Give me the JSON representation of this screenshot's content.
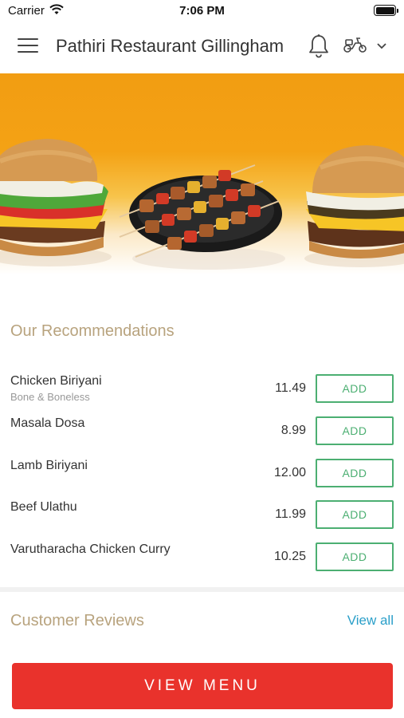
{
  "status_bar": {
    "carrier": "Carrier",
    "time": "7:06 PM"
  },
  "header": {
    "title": "Pathiri Restaurant Gillingham",
    "icons": [
      "menu-icon",
      "bell-icon",
      "scooter-icon",
      "chevron-down-icon"
    ]
  },
  "hero": {
    "image": "burger-kebab-banner",
    "colors": {
      "top": "#f29d12",
      "bottom": "#ffffff"
    }
  },
  "recommendations": {
    "title": "Our Recommendations",
    "add_label": "ADD",
    "items": [
      {
        "name": "Chicken Biriyani",
        "subtitle": "Bone & Boneless",
        "price": "11.49"
      },
      {
        "name": "Masala Dosa",
        "subtitle": "",
        "price": "8.99"
      },
      {
        "name": "Lamb Biriyani",
        "subtitle": "",
        "price": "12.00"
      },
      {
        "name": "Beef Ulathu",
        "subtitle": "",
        "price": "11.99"
      },
      {
        "name": "Varutharacha Chicken Curry",
        "subtitle": "",
        "price": "10.25"
      }
    ]
  },
  "reviews": {
    "title": "Customer Reviews",
    "view_all": "View all"
  },
  "cta": {
    "label": "VIEW MENU",
    "color": "#e9322c"
  },
  "colors": {
    "section_title": "#b8a37e",
    "add_button": "#4caf72",
    "link": "#2a9fc9"
  }
}
